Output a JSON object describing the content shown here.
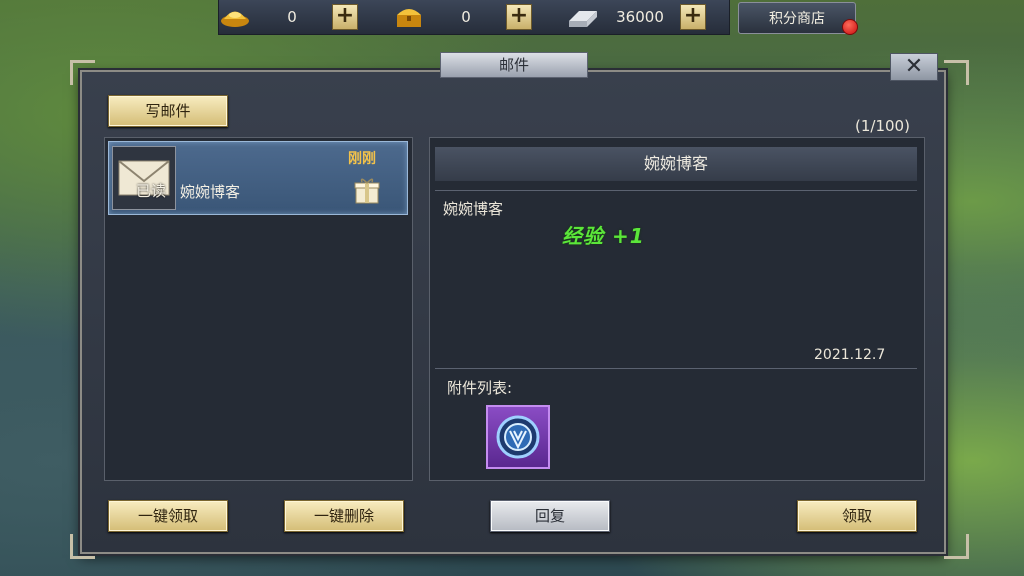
{
  "resources": [
    {
      "icon": "gold-ingot-icon",
      "value": "0"
    },
    {
      "icon": "treasure-chest-icon",
      "value": "0"
    },
    {
      "icon": "silver-ingot-icon",
      "value": "36000"
    }
  ],
  "points_shop_label": "积分商店",
  "window_title": "邮件",
  "close_label": "✕",
  "compose_label": "写邮件",
  "mail_count": "(1/100)",
  "mail_list": [
    {
      "status": "已读",
      "sender": "婉婉博客",
      "time": "刚刚",
      "has_attachment": true
    }
  ],
  "detail": {
    "title": "婉婉博客",
    "sender": "婉婉博客",
    "reward_text": "经验 +1",
    "date": "2021.12.7",
    "attachments_label": "附件列表:"
  },
  "buttons": {
    "claim_all": "一键领取",
    "delete_all": "一键删除",
    "reply": "回复",
    "claim": "领取"
  },
  "colors": {
    "reward": "#5be63a",
    "time": "#f3c24a",
    "selected": "#4d6a8e"
  }
}
